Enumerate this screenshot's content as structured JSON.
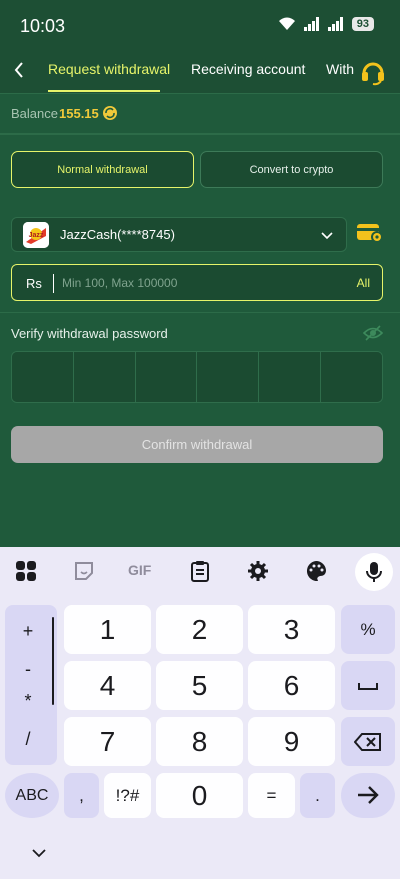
{
  "status_bar": {
    "time": "10:03",
    "battery": "93"
  },
  "header": {
    "tabs": [
      "Request withdrawal",
      "Receiving account",
      "With"
    ],
    "active_tab_index": 0,
    "accent_color": "#e6f46a"
  },
  "balance": {
    "label": "Balance",
    "value": "155.15"
  },
  "withdraw_modes": {
    "normal": "Normal withdrawal",
    "crypto": "Convert to crypto",
    "selected": "normal"
  },
  "account": {
    "name": "JazzCash(****8745)",
    "logo_icon": "jazzcash-logo-icon"
  },
  "amount": {
    "currency": "Rs",
    "placeholder": "Min 100, Max 100000",
    "value": "",
    "all_label": "All"
  },
  "password": {
    "label": "Verify withdrawal password",
    "digits": 6
  },
  "confirm": {
    "label": "Confirm withdrawal"
  },
  "keyboard": {
    "gif_label": "GIF",
    "symbols": [
      "+",
      "-",
      "*",
      "/"
    ],
    "digits": [
      "1",
      "2",
      "3",
      "4",
      "5",
      "6",
      "7",
      "8",
      "9",
      "0"
    ],
    "percent": "%",
    "comma": ",",
    "punct": "!?#",
    "equals": "=",
    "dot": ".",
    "abc": "ABC"
  }
}
